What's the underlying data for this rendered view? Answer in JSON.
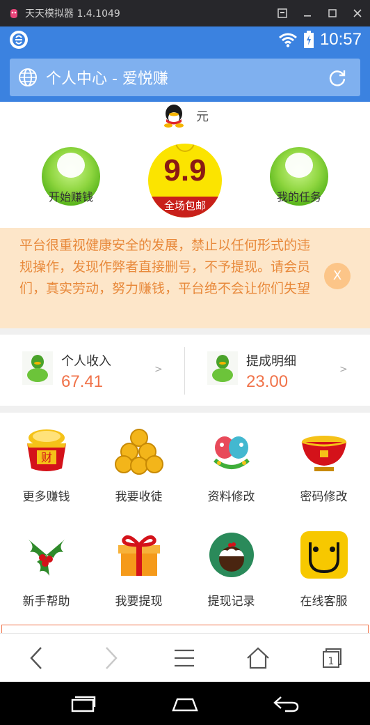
{
  "emulator": {
    "title": "天天模拟器 1.4.1049"
  },
  "status_bar": {
    "time": "10:57"
  },
  "browser": {
    "page_title": "个人中心 - 爱悦赚"
  },
  "profile": {
    "currency": "元"
  },
  "actions": {
    "start_earning": "开始赚钱",
    "my_tasks": "我的任务",
    "promo_number": "9.9",
    "promo_band": "全场包邮"
  },
  "notice": {
    "text": "平台很重视健康安全的发展，禁止以任何形式的违规操作，发现作弊者直接删号，不予提现。请会员们，真实劳动，努力赚钱，平台绝不会让你们失望",
    "close_label": "X"
  },
  "income": [
    {
      "title": "个人收入",
      "value": "67.41",
      "arrow": ">"
    },
    {
      "title": "提成明细",
      "value": "23.00",
      "arrow": ">"
    }
  ],
  "menu": [
    {
      "label": "更多赚钱",
      "icon": "money-bucket-icon"
    },
    {
      "label": "我要收徒",
      "icon": "gold-coins-icon"
    },
    {
      "label": "资料修改",
      "icon": "parrots-icon"
    },
    {
      "label": "密码修改",
      "icon": "golden-bowl-icon"
    },
    {
      "label": "新手帮助",
      "icon": "holly-icon"
    },
    {
      "label": "我要提现",
      "icon": "gift-box-icon"
    },
    {
      "label": "提现记录",
      "icon": "pudding-icon"
    },
    {
      "label": "在线客服",
      "icon": "smiley-face-icon"
    }
  ],
  "colors": {
    "accent_blue": "#3b82e0",
    "notice_bg": "#fde6c9",
    "notice_text": "#e8893b",
    "value_orange": "#f0734a"
  }
}
